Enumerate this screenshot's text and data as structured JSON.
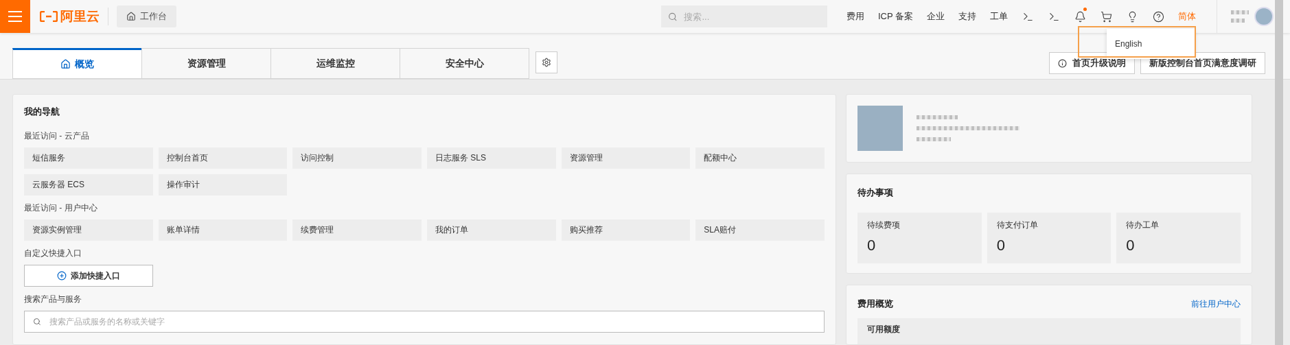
{
  "topbar": {
    "brand": "阿里云",
    "workbench": "工作台",
    "search": {
      "placeholder": "搜索..."
    },
    "links": [
      "费用",
      "ICP 备案",
      "企业",
      "支持",
      "工单"
    ],
    "notifications_unread": true,
    "language": {
      "label": "简体",
      "active": true
    }
  },
  "language_menu": {
    "options": [
      "English"
    ]
  },
  "tabs": [
    {
      "label": "概览",
      "selected": true
    },
    {
      "label": "资源管理",
      "selected": false
    },
    {
      "label": "运维监控",
      "selected": false
    },
    {
      "label": "安全中心",
      "selected": false
    }
  ],
  "header_buttons": [
    {
      "label": "首页升级说明",
      "kind": "info"
    },
    {
      "label": "新版控制台首页满意度调研",
      "kind": "plain"
    }
  ],
  "navigation": {
    "title": "我的导航",
    "sections": [
      {
        "heading": "最近访问 - 云产品",
        "items": [
          "短信服务",
          "控制台首页",
          "访问控制",
          "日志服务 SLS",
          "资源管理",
          "配额中心",
          "云服务器 ECS",
          "操作审计"
        ]
      },
      {
        "heading": "最近访问 - 用户中心",
        "items": [
          "资源实例管理",
          "账单详情",
          "续费管理",
          "我的订单",
          "购买推荐",
          "SLA赔付"
        ]
      }
    ],
    "custom": {
      "heading": "自定义快捷入口",
      "add_button": "添加快捷入口"
    },
    "search": {
      "heading": "搜索产品与服务",
      "placeholder": "搜索产品或服务的名称或关键字"
    }
  },
  "todo": {
    "title": "待办事项",
    "items": [
      {
        "label": "待续费项",
        "count": "0"
      },
      {
        "label": "待支付订单",
        "count": "0"
      },
      {
        "label": "待办工单",
        "count": "0"
      }
    ]
  },
  "fees": {
    "title": "费用概览",
    "link": "前往用户中心",
    "sub_label": "可用额度"
  }
}
